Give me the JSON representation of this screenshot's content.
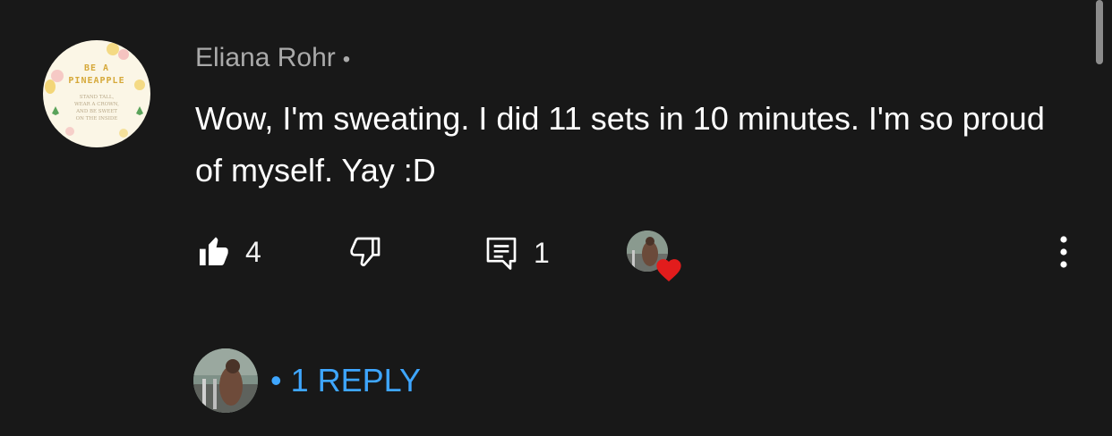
{
  "comment": {
    "author": "Eliana Rohr",
    "separator": "•",
    "text": "Wow, I'm sweating. I did 11 sets in 10 minutes. I'm so proud of myself. Yay :D",
    "avatar": {
      "line1": "BE A",
      "line2": "PINEAPPLE",
      "small_lines": [
        "STAND TALL,",
        "WEAR A CROWN,",
        "AND BE SWEET",
        "ON THE INSIDE"
      ]
    },
    "likes": "4",
    "replies_count": "1",
    "heart_color": "#e21c1c"
  },
  "replies": {
    "toggle_label": "• 1 REPLY",
    "accent": "#3ea6ff"
  },
  "icons": {
    "like": "thumbs-up-icon",
    "dislike": "thumbs-down-icon",
    "reply": "comment-icon",
    "heart": "heart-icon",
    "more": "more-vert-icon"
  }
}
